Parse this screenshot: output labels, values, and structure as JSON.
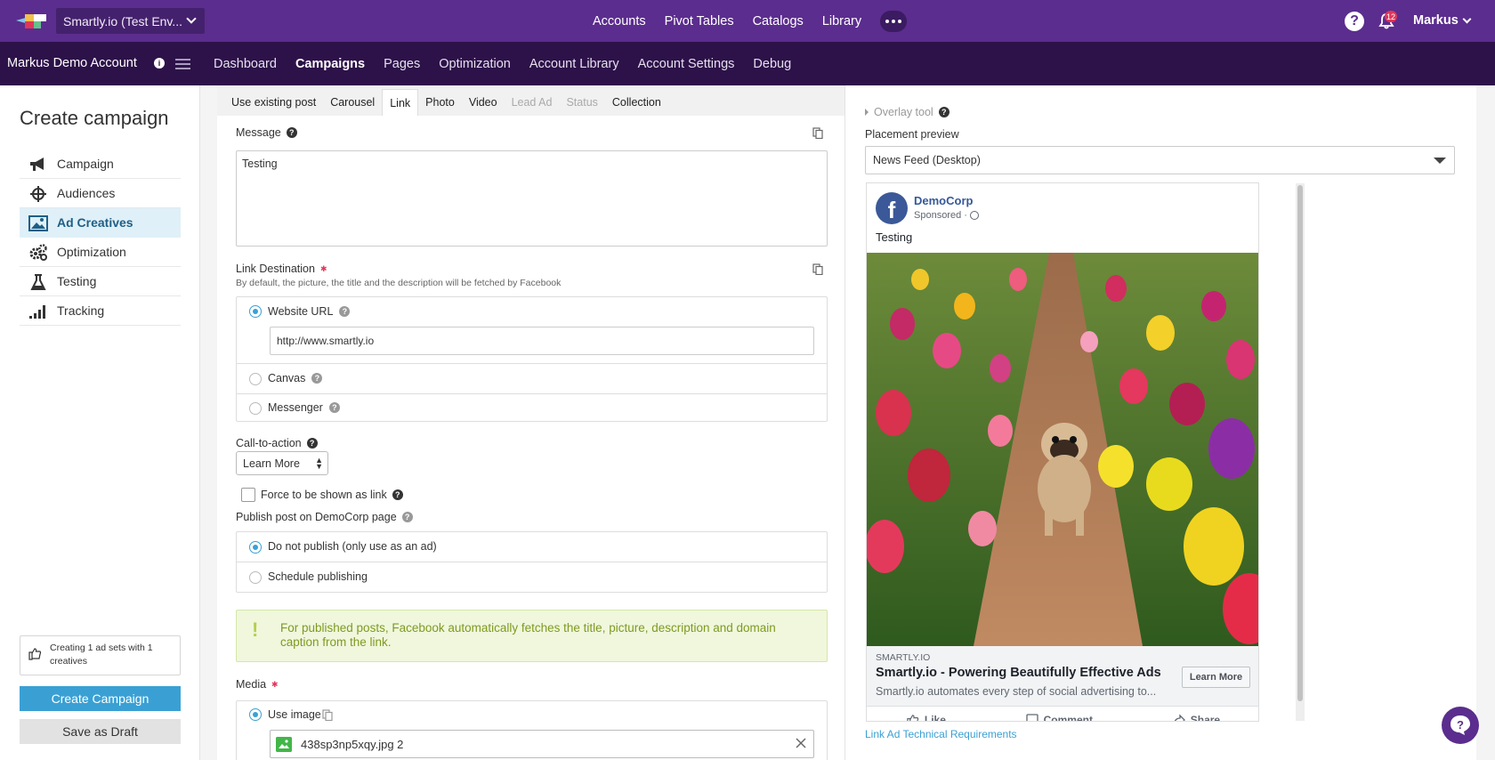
{
  "topbar": {
    "env_label": "Smartly.io (Test Env...",
    "nav": [
      "Accounts",
      "Pivot Tables",
      "Catalogs",
      "Library"
    ],
    "notification_count": "12",
    "user": "Markus"
  },
  "subbar": {
    "account": "Markus Demo Account",
    "nav": [
      "Dashboard",
      "Campaigns",
      "Pages",
      "Optimization",
      "Account Library",
      "Account Settings",
      "Debug"
    ],
    "active": "Campaigns"
  },
  "left": {
    "title": "Create campaign",
    "items": [
      {
        "label": "Campaign",
        "icon": "megaphone-icon"
      },
      {
        "label": "Audiences",
        "icon": "crosshair-icon"
      },
      {
        "label": "Ad Creatives",
        "icon": "image-icon"
      },
      {
        "label": "Optimization",
        "icon": "gears-icon"
      },
      {
        "label": "Testing",
        "icon": "flask-icon"
      },
      {
        "label": "Tracking",
        "icon": "signal-bars-icon"
      }
    ],
    "active": "Ad Creatives",
    "summary": "Creating 1 ad sets with 1 creatives",
    "create_button": "Create Campaign",
    "draft_button": "Save as Draft"
  },
  "form": {
    "tabs": [
      {
        "label": "Use existing post",
        "state": "normal"
      },
      {
        "label": "Carousel",
        "state": "normal"
      },
      {
        "label": "Link",
        "state": "active"
      },
      {
        "label": "Photo",
        "state": "normal"
      },
      {
        "label": "Video",
        "state": "normal"
      },
      {
        "label": "Lead Ad",
        "state": "disabled"
      },
      {
        "label": "Status",
        "state": "disabled"
      },
      {
        "label": "Collection",
        "state": "normal"
      }
    ],
    "message_label": "Message",
    "message_value": "Testing",
    "link_label": "Link Destination",
    "link_hint": "By default, the picture, the title and the description will be fetched by Facebook",
    "website_label": "Website URL",
    "website_value": "http://www.smartly.io",
    "canvas_label": "Canvas",
    "messenger_label": "Messenger",
    "cta_label": "Call-to-action",
    "cta_value": "Learn More",
    "force_label": "Force to be shown as link",
    "publish_label": "Publish post on DemoCorp page",
    "publish_no": "Do not publish (only use as an ad)",
    "publish_schedule": "Schedule publishing",
    "notice": "For published posts, Facebook automatically fetches the title, picture, description and domain caption from the link.",
    "media_label": "Media",
    "use_image_label": "Use image",
    "image_file": "438sp3np5xqy.jpg 2"
  },
  "preview": {
    "overlay_label": "Overlay tool",
    "placement_label": "Placement preview",
    "placement_value": "News Feed (Desktop)",
    "page_name": "DemoCorp",
    "sponsored": "Sponsored ·",
    "message": "Testing",
    "domain": "SMARTLY.IO",
    "headline": "Smartly.io - Powering Beautifully Effective Ads",
    "description": "Smartly.io automates every step of social advertising to...",
    "cta_button": "Learn More",
    "actions": [
      "Like",
      "Comment",
      "Share"
    ],
    "requirements_link": "Link Ad Technical Requirements"
  },
  "colors": {
    "topbar": "#5b2d8e",
    "subbar": "#2d1249",
    "accent": "#3aa0d4",
    "active_nav_bg": "#dff0f8",
    "notice_bg": "#f0f7dc",
    "facebook": "#3b5998"
  }
}
